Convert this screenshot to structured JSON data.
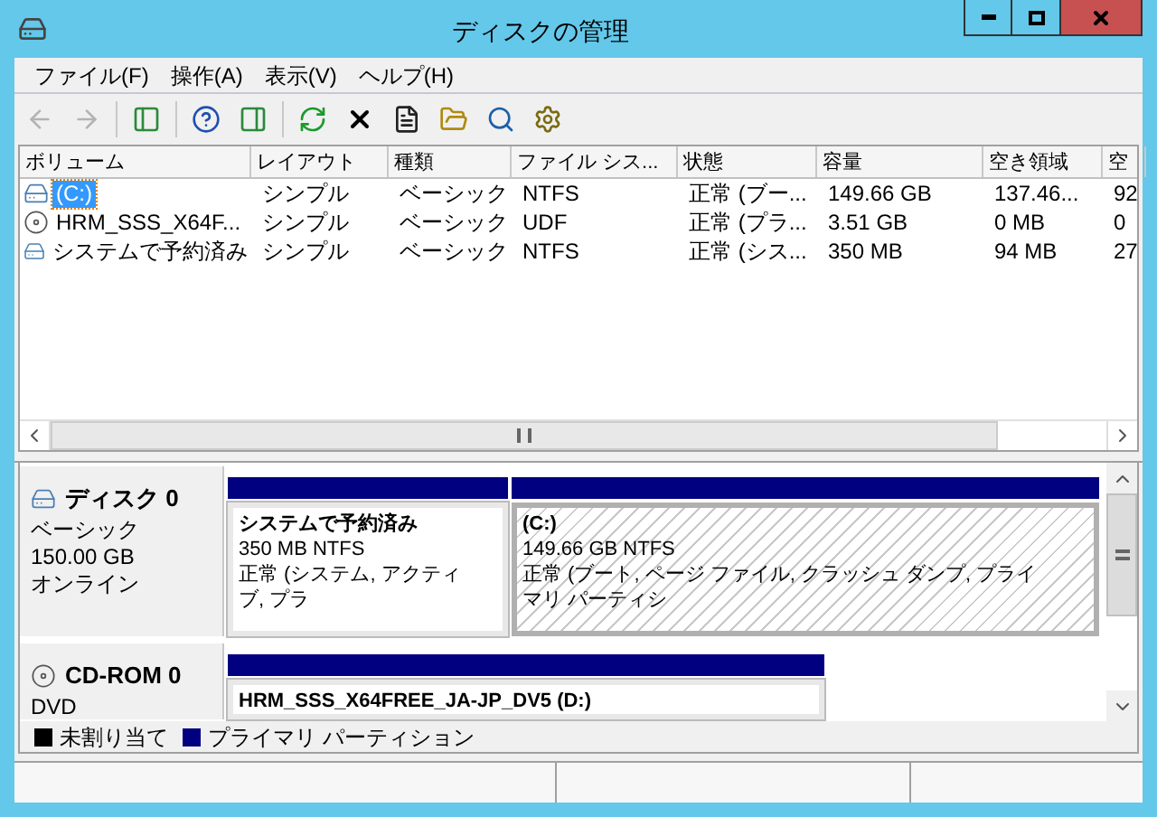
{
  "window": {
    "title": "ディスクの管理"
  },
  "menu": [
    {
      "label": "ファイル(F)"
    },
    {
      "label": "操作(A)"
    },
    {
      "label": "表示(V)"
    },
    {
      "label": "ヘルプ(H)"
    }
  ],
  "toolbar": [
    {
      "kind": "back",
      "disabled": true
    },
    {
      "kind": "forward",
      "disabled": true
    },
    {
      "kind": "sep"
    },
    {
      "kind": "tree",
      "disabled": false
    },
    {
      "kind": "sep"
    },
    {
      "kind": "help",
      "disabled": false
    },
    {
      "kind": "pane",
      "disabled": false
    },
    {
      "kind": "sep"
    },
    {
      "kind": "refresh",
      "disabled": false
    },
    {
      "kind": "delete",
      "disabled": false
    },
    {
      "kind": "properties",
      "disabled": false
    },
    {
      "kind": "open",
      "disabled": false
    },
    {
      "kind": "search",
      "disabled": false
    },
    {
      "kind": "wizard",
      "disabled": false
    }
  ],
  "volumes": {
    "columns": [
      "ボリューム",
      "レイアウト",
      "種類",
      "ファイル シス...",
      "状態",
      "容量",
      "空き領域",
      "空"
    ],
    "rows": [
      {
        "kind": "hdd",
        "selected": true,
        "cells": [
          "(C:)",
          "シンプル",
          "ベーシック",
          "NTFS",
          "正常 (ブー...",
          "149.66 GB",
          "137.46...",
          "92"
        ]
      },
      {
        "kind": "cd",
        "selected": false,
        "cells": [
          "HRM_SSS_X64F...",
          "シンプル",
          "ベーシック",
          "UDF",
          "正常 (プラ...",
          "3.51 GB",
          "0 MB",
          "0"
        ]
      },
      {
        "kind": "hdd",
        "selected": false,
        "cells": [
          "システムで予約済み",
          "シンプル",
          "ベーシック",
          "NTFS",
          "正常 (シス...",
          "350 MB",
          "94 MB",
          "27"
        ]
      }
    ]
  },
  "disks": [
    {
      "kind": "hdd",
      "name": "ディスク 0",
      "type": "ベーシック",
      "size": "150.00 GB",
      "status": "オンライン",
      "partitions": [
        {
          "name": "システムで予約済み",
          "detail": "350 MB NTFS",
          "status": "正常 (システム, アクティブ, プラ",
          "selected": false
        },
        {
          "name": "(C:)",
          "detail": "149.66 GB NTFS",
          "status": "正常 (ブート, ページ ファイル, クラッシュ ダンプ, プライマリ パーティシ",
          "selected": true
        }
      ]
    },
    {
      "kind": "cd",
      "name": "CD-ROM 0",
      "type": "DVD",
      "partitions": [
        {
          "name": "HRM_SSS_X64FREE_JA-JP_DV5 (D:)",
          "selected": false
        }
      ]
    }
  ],
  "legend": [
    {
      "label": "未割り当て",
      "color": "#000000"
    },
    {
      "label": "プライマリ パーティション",
      "color": "#000080"
    }
  ]
}
